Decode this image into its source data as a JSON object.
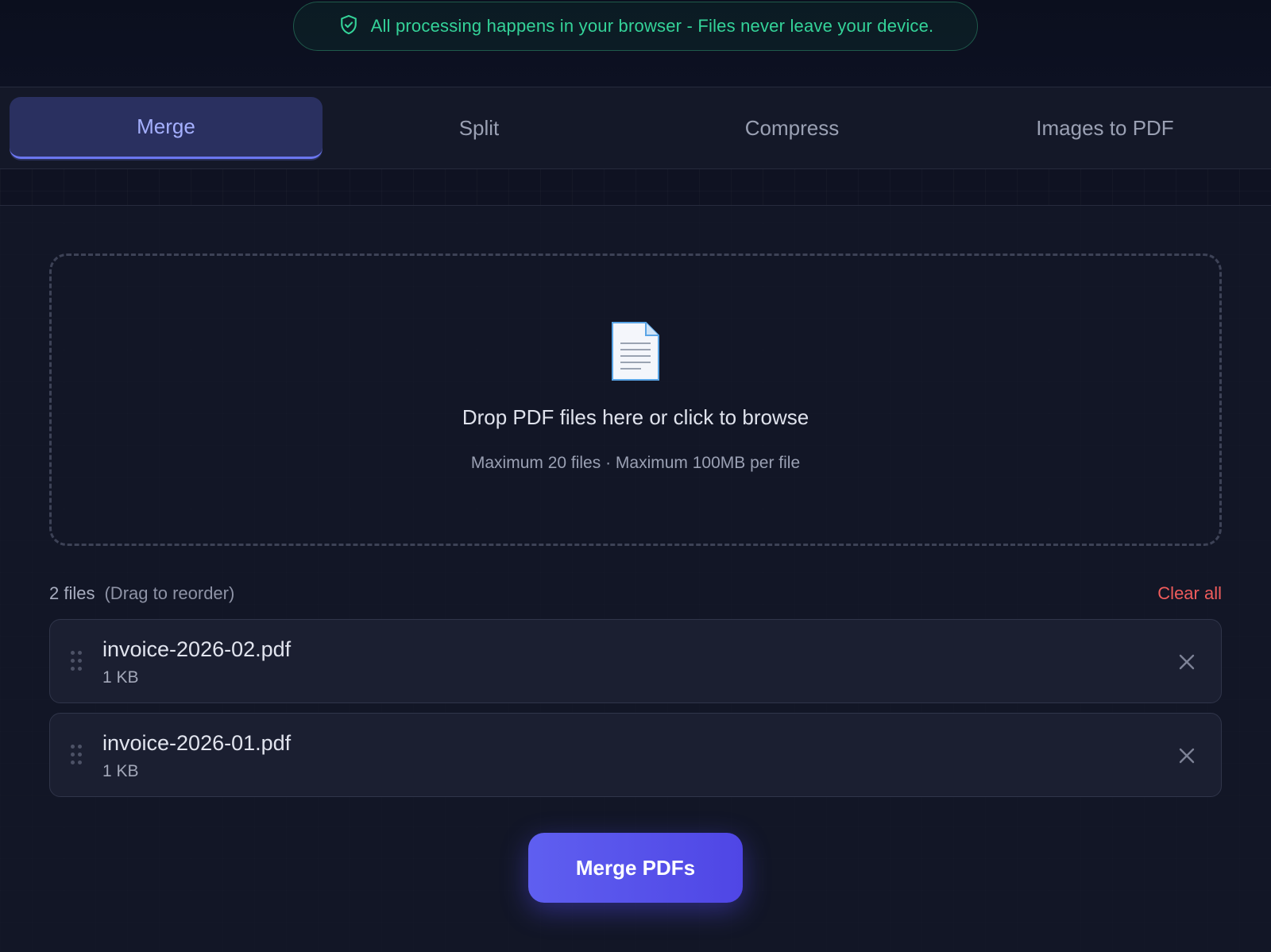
{
  "banner": {
    "text": "All processing happens in your browser - Files never leave your device.",
    "icon": "shield-check-icon"
  },
  "tabs": [
    {
      "label": "Merge",
      "active": true
    },
    {
      "label": "Split",
      "active": false
    },
    {
      "label": "Compress",
      "active": false
    },
    {
      "label": "Images to PDF",
      "active": false
    }
  ],
  "dropzone": {
    "icon": "document-icon",
    "title": "Drop PDF files here or click to browse",
    "subtitle": "Maximum 20 files · Maximum 100MB per file"
  },
  "files": {
    "count_label": "2 files",
    "hint": "(Drag to reorder)",
    "clear_label": "Clear all",
    "items": [
      {
        "name": "invoice-2026-02.pdf",
        "size": "1 KB"
      },
      {
        "name": "invoice-2026-01.pdf",
        "size": "1 KB"
      }
    ]
  },
  "action": {
    "merge_label": "Merge PDFs"
  },
  "colors": {
    "accent": "#4f46e5",
    "success": "#34d399",
    "danger": "#ef5c5c",
    "background": "#0f1222"
  }
}
